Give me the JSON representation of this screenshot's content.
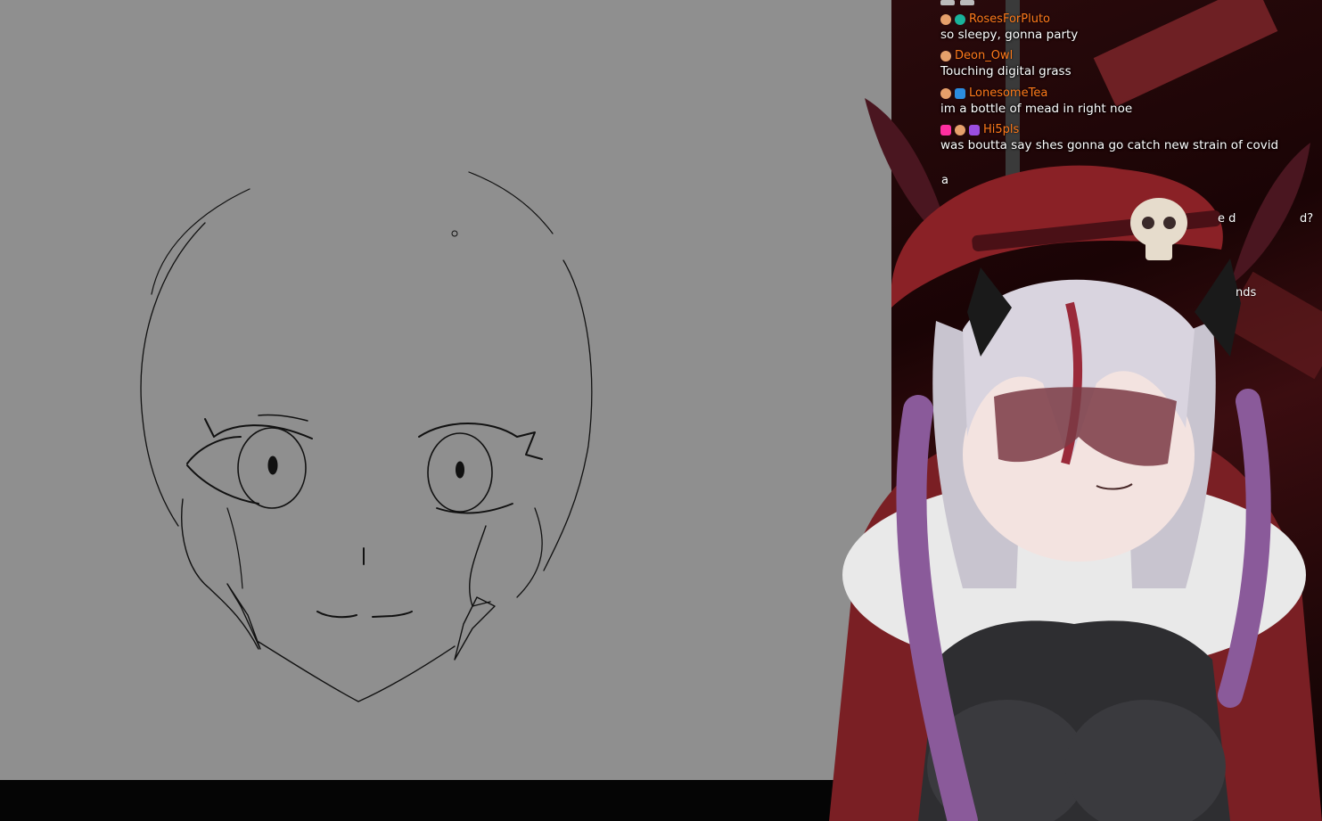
{
  "chat": {
    "messages": [
      {
        "username": "RosesForPluto",
        "text": "so sleepy, gonna party",
        "badges": [
          "face",
          "teal"
        ]
      },
      {
        "username": "Deon_Owl",
        "text": "Touching digital grass",
        "badges": [
          "face"
        ]
      },
      {
        "username": "LonesomeTea",
        "text": "im a bottle of mead in right noe",
        "badges": [
          "face",
          "blue"
        ]
      },
      {
        "username": "Hi5pls",
        "text": "was boutta say shes gonna go catch new strain of covid",
        "badges": [
          "pink",
          "face",
          "purple"
        ]
      }
    ],
    "fragments": [
      "a",
      "e d",
      "d?",
      "nds"
    ]
  },
  "colors": {
    "canvas_bg": "#8f8f8f",
    "username": "#ff7a1a",
    "chat_text": "#ffffff",
    "stroke": "#111111"
  }
}
